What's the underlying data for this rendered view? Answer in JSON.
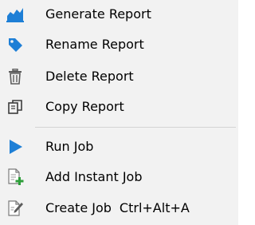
{
  "menu": {
    "items": [
      {
        "label": "Generate Report",
        "icon": "chart-area-icon",
        "shortcut": ""
      },
      {
        "label": "Rename Report",
        "icon": "tag-icon",
        "shortcut": ""
      },
      {
        "label": "Delete Report",
        "icon": "trash-icon",
        "shortcut": ""
      },
      {
        "label": "Copy Report",
        "icon": "copy-icon",
        "shortcut": ""
      },
      {
        "label": "Run Job",
        "icon": "play-icon",
        "shortcut": ""
      },
      {
        "label": "Add Instant Job",
        "icon": "add-job-icon",
        "shortcut": ""
      },
      {
        "label": "Create Job",
        "icon": "edit-job-icon",
        "shortcut": "Ctrl+Alt+A"
      }
    ]
  },
  "colors": {
    "accent": "#1e7fd6",
    "menu_background": "#f2f2f2",
    "separator": "#d4d4d4",
    "icon_gray": "#5c5c5c",
    "add_green": "#2e9e3a"
  }
}
